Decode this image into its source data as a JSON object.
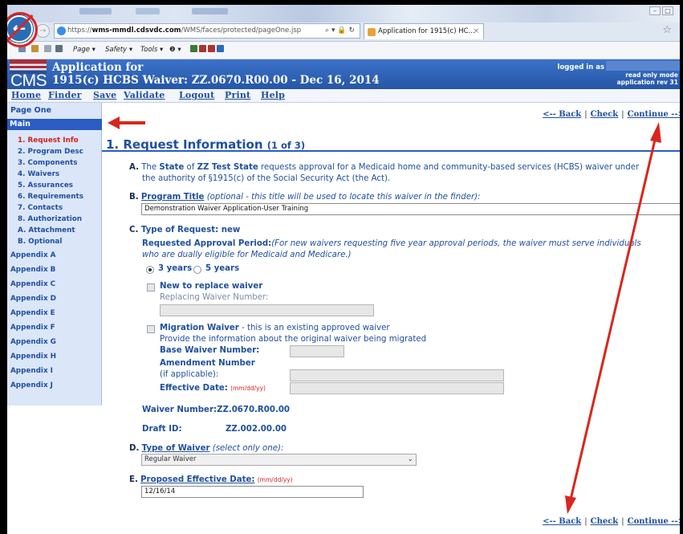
{
  "browser": {
    "url_prefix": "https://",
    "url_host": "wms-mmdl.cdsvdc.com",
    "url_path": "/WMS/faces/protected/pageOne.jsp",
    "url_icons": "⌕ ▾ 🔒 ↻",
    "tab_title": "Application for 1915(c) HC...",
    "tab_close": "×",
    "cmd_page": "Page ▾",
    "cmd_safety": "Safety ▾",
    "cmd_tools": "Tools ▾",
    "cmd_help": "❷ ▾",
    "back_glyph": "←",
    "forward_glyph": "→",
    "star_glyph": "☆"
  },
  "banner": {
    "logo": "CMS",
    "title_line1": "Application for",
    "title_line2": "1915(c) HCBS Waiver: ZZ.0670.R00.00 - Dec 16, 2014",
    "logged_in": "logged in as",
    "read_only": "read only mode",
    "app_rev": "application rev 31"
  },
  "menu": [
    "Home",
    "Finder",
    "Save",
    "Validate",
    "Logout",
    "Print",
    "Help"
  ],
  "sidebar": {
    "page_one": "Page One",
    "main": "Main",
    "sub_items": [
      "1. Request Info",
      "2. Program Desc",
      "3. Components",
      "4. Waivers",
      "5. Assurances",
      "6. Requirements",
      "7. Contacts",
      "8. Authorization",
      "A. Attachment",
      "B. Optional"
    ],
    "appendices": [
      "Appendix A",
      "Appendix B",
      "Appendix C",
      "Appendix D",
      "Appendix E",
      "Appendix F",
      "Appendix G",
      "Appendix H",
      "Appendix I",
      "Appendix J"
    ]
  },
  "nav": {
    "back": "<-- Back",
    "check": "Check",
    "continue": "Continue -->",
    "sep": "|"
  },
  "section": {
    "title": "1. Request Information",
    "of": "(1 of 3)"
  },
  "itemA": {
    "letter": "A.",
    "pre": "The",
    "state_label": "State",
    "of_word": "of",
    "state_name": "ZZ Test State",
    "rest_line1": "requests approval for a Medicaid home and community-based services (HCBS) waiver under",
    "line2": "the authority of §1915(c) of the Social Security Act (the Act)."
  },
  "itemB": {
    "letter": "B.",
    "label": "Program Title",
    "hint": "(optional - this title will be used to locate this waiver in the finder):",
    "value": "Demonstration Waiver Application-User Training"
  },
  "itemC": {
    "letter": "C.",
    "label": "Type of Request: new",
    "period_label": "Requested Approval Period:",
    "period_hint_1": "(For new waivers requesting five year approval periods, the waiver must serve individuals",
    "period_hint_2": "who are dually eligible for Medicaid and Medicare.)",
    "opt_3yr": "3 years",
    "opt_5yr": "5 years",
    "new_replace": "New to replace waiver",
    "replacing_label": "Replacing Waiver Number:",
    "migration_bold": "Migration Waiver",
    "migration_rest": "- this is an existing approved waiver",
    "migration_line2": "Provide the information about the original waiver being migrated",
    "base_label": "Base Waiver Number:",
    "amend_label": "Amendment Number",
    "amend_hint": "(if applicable):",
    "eff_label": "Effective Date:",
    "eff_fmt": "(mm/dd/yy)"
  },
  "waiver_number_label": "Waiver Number:",
  "waiver_number": "ZZ.0670.R00.00",
  "draft_id_label": "Draft ID:",
  "draft_id": "ZZ.002.00.00",
  "itemD": {
    "letter": "D.",
    "label": "Type of Waiver",
    "hint": "(select only one):",
    "value": "Regular Waiver",
    "caret": "⌄"
  },
  "itemE": {
    "letter": "E.",
    "label": "Proposed Effective Date:",
    "fmt": "(mm/dd/yy)",
    "value": "12/16/14"
  },
  "colors": {
    "brand_blue": "#2a5cc2",
    "link_blue": "#1f4fa0",
    "annotation_red": "#d9261c"
  }
}
